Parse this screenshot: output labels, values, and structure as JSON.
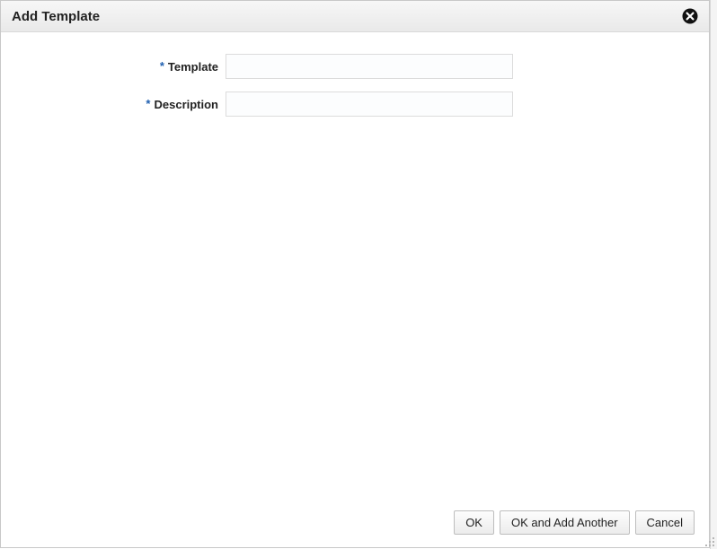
{
  "dialog": {
    "title": "Add Template",
    "required_indicator": "*",
    "fields": {
      "template": {
        "label": "Template",
        "value": ""
      },
      "description": {
        "label": "Description",
        "value": ""
      }
    },
    "buttons": {
      "ok": "OK",
      "ok_add_another": "OK and Add Another",
      "cancel": "Cancel"
    }
  }
}
